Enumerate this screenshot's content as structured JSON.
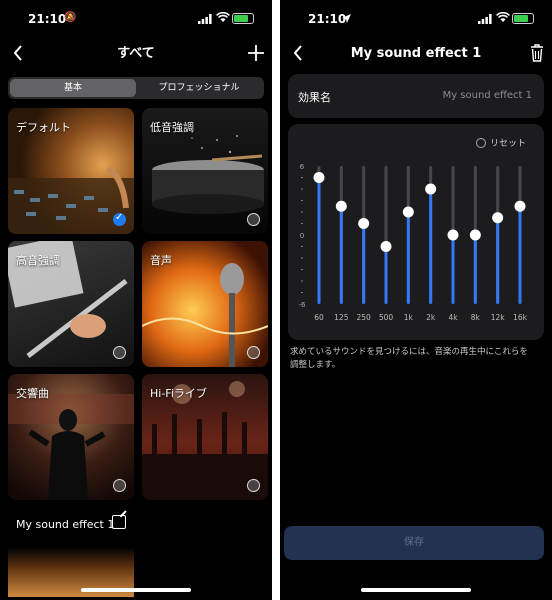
{
  "left": {
    "status": {
      "time": "21:10",
      "time_icon": "silent-bell-icon"
    },
    "nav": {
      "title": "すべて"
    },
    "tabs": [
      {
        "label": "基本",
        "active": true
      },
      {
        "label": "プロフェッショナル",
        "active": false
      }
    ],
    "presets": [
      {
        "label": "デフォルト",
        "selected": true
      },
      {
        "label": "低音強調",
        "selected": false
      },
      {
        "label": "高音強調",
        "selected": false
      },
      {
        "label": "音声",
        "selected": false
      },
      {
        "label": "交響曲",
        "selected": false
      },
      {
        "label": "Hi-Fiライブ",
        "selected": false
      },
      {
        "label": "My sound effect 1",
        "selected": false,
        "editable": true
      }
    ]
  },
  "right": {
    "status": {
      "time": "21:10",
      "time_icon": "location-arrow-icon"
    },
    "nav": {
      "title": "My sound effect 1"
    },
    "name_row": {
      "label": "効果名",
      "value": "My sound effect 1"
    },
    "eq": {
      "reset_label": "リセット",
      "y_labels": [
        "6",
        "0",
        "-6"
      ],
      "bands": [
        {
          "freq": "60",
          "gain": 5
        },
        {
          "freq": "125",
          "gain": 2.5
        },
        {
          "freq": "250",
          "gain": 1
        },
        {
          "freq": "500",
          "gain": -1
        },
        {
          "freq": "1k",
          "gain": 2
        },
        {
          "freq": "2k",
          "gain": 4
        },
        {
          "freq": "4k",
          "gain": 0
        },
        {
          "freq": "8k",
          "gain": 0
        },
        {
          "freq": "12k",
          "gain": 1.5
        },
        {
          "freq": "16k",
          "gain": 2.5
        }
      ],
      "range": [
        -6,
        6
      ]
    },
    "hint": "求めているサウンドを見つけるには、音楽の再生中にこれらを調整します。",
    "save_label": "保存"
  },
  "colors": {
    "accent": "#1e7cf2",
    "slider": "#3478f6",
    "card": "#1c1c1e",
    "save_bg": "#233250"
  }
}
